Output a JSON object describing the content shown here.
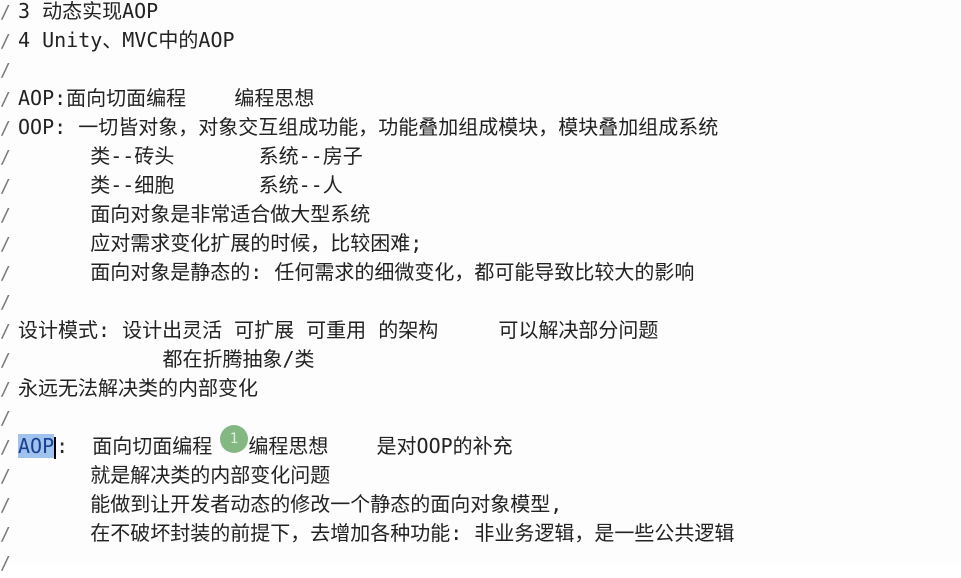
{
  "lines": [
    "3 动态实现AOP",
    "4 Unity、MVC中的AOP",
    "",
    "AOP:面向切面编程    编程思想",
    "OOP: 一切皆对象，对象交互组成功能，功能叠加组成模块，模块叠加组成系统",
    "      类--砖头       系统--房子",
    "      类--细胞       系统--人",
    "      面向对象是非常适合做大型系统",
    "      应对需求变化扩展的时候，比较困难;",
    "      面向对象是静态的: 任何需求的细微变化，都可能导致比较大的影响",
    "",
    "设计模式: 设计出灵活 可扩展 可重用 的架构     可以解决部分问题",
    "            都在折腾抽象/类",
    "永远无法解决类的内部变化",
    "",
    "",
    "      就是解决类的内部变化问题",
    "      能做到让开发者动态的修改一个静态的面向对象模型,",
    "      在不破坏封装的前提下，去增加各种功能: 非业务逻辑，是一些公共逻辑",
    ""
  ],
  "selected_line": {
    "selected_text": "AOP",
    "rest": ":  面向切面编程   编程思想    是对OOP的补充"
  },
  "comment_marker": "/",
  "cursor_label": "1"
}
